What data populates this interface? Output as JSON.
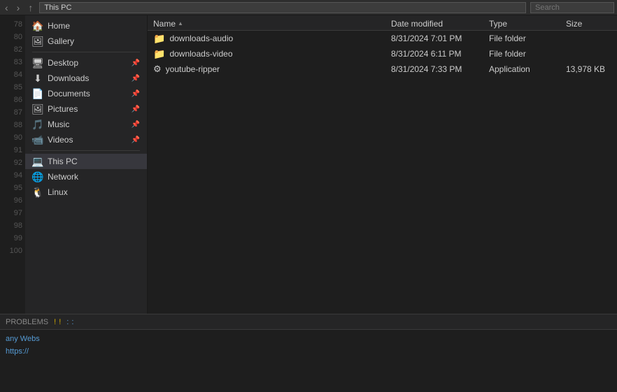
{
  "toolbar": {
    "nav_back": "‹",
    "nav_forward": "›",
    "nav_up": "↑",
    "address": "This PC",
    "search_placeholder": "Search"
  },
  "sidebar": {
    "quick_access": [
      {
        "id": "home",
        "label": "Home",
        "icon": "🏠",
        "pinned": false
      },
      {
        "id": "gallery",
        "label": "Gallery",
        "icon": "🖼",
        "pinned": false
      }
    ],
    "pinned": [
      {
        "id": "desktop",
        "label": "Desktop",
        "icon": "🖥",
        "pinned": true
      },
      {
        "id": "downloads",
        "label": "Downloads",
        "icon": "⬇",
        "pinned": true
      },
      {
        "id": "documents",
        "label": "Documents",
        "icon": "📄",
        "pinned": true
      },
      {
        "id": "pictures",
        "label": "Pictures",
        "icon": "🖼",
        "pinned": true
      },
      {
        "id": "music",
        "label": "Music",
        "icon": "🎵",
        "pinned": true
      },
      {
        "id": "videos",
        "label": "Videos",
        "icon": "📹",
        "pinned": true
      }
    ],
    "system": [
      {
        "id": "this-pc",
        "label": "This PC",
        "icon": "💻",
        "active": true
      },
      {
        "id": "network",
        "label": "Network",
        "icon": "🌐"
      },
      {
        "id": "linux",
        "label": "Linux",
        "icon": "🐧"
      }
    ]
  },
  "file_list": {
    "columns": [
      {
        "id": "name",
        "label": "Name",
        "sort": "asc"
      },
      {
        "id": "date",
        "label": "Date modified"
      },
      {
        "id": "type",
        "label": "Type"
      },
      {
        "id": "size",
        "label": "Size"
      }
    ],
    "rows": [
      {
        "name": "downloads-audio",
        "date": "8/31/2024 7:01 PM",
        "type": "File folder",
        "size": "",
        "icon": "folder"
      },
      {
        "name": "downloads-video",
        "date": "8/31/2024 6:11 PM",
        "type": "File folder",
        "size": "",
        "icon": "folder"
      },
      {
        "name": "youtube-ripper",
        "date": "8/31/2024 7:33 PM",
        "type": "Application",
        "size": "13,978 KB",
        "icon": "app"
      }
    ]
  },
  "line_numbers": [
    "78",
    "",
    "80",
    "",
    "82",
    "83",
    "84",
    "85",
    "86",
    "87",
    "88",
    "",
    "90",
    "91",
    "92",
    "",
    "94",
    "95",
    "96",
    "97",
    "98",
    "99",
    "100"
  ],
  "problems_bar": {
    "label": "PROBLEMS",
    "error_items": [
      {
        "dots": [
          "yellow",
          "blue"
        ],
        "text": "! !"
      },
      {
        "dots": [
          "yellow",
          "blue"
        ],
        "text": ": :"
      }
    ]
  },
  "terminal": {
    "lines": [
      {
        "type": "url",
        "text": "https://"
      }
    ],
    "label": "any Webs"
  },
  "status_bar": {
    "items": []
  }
}
